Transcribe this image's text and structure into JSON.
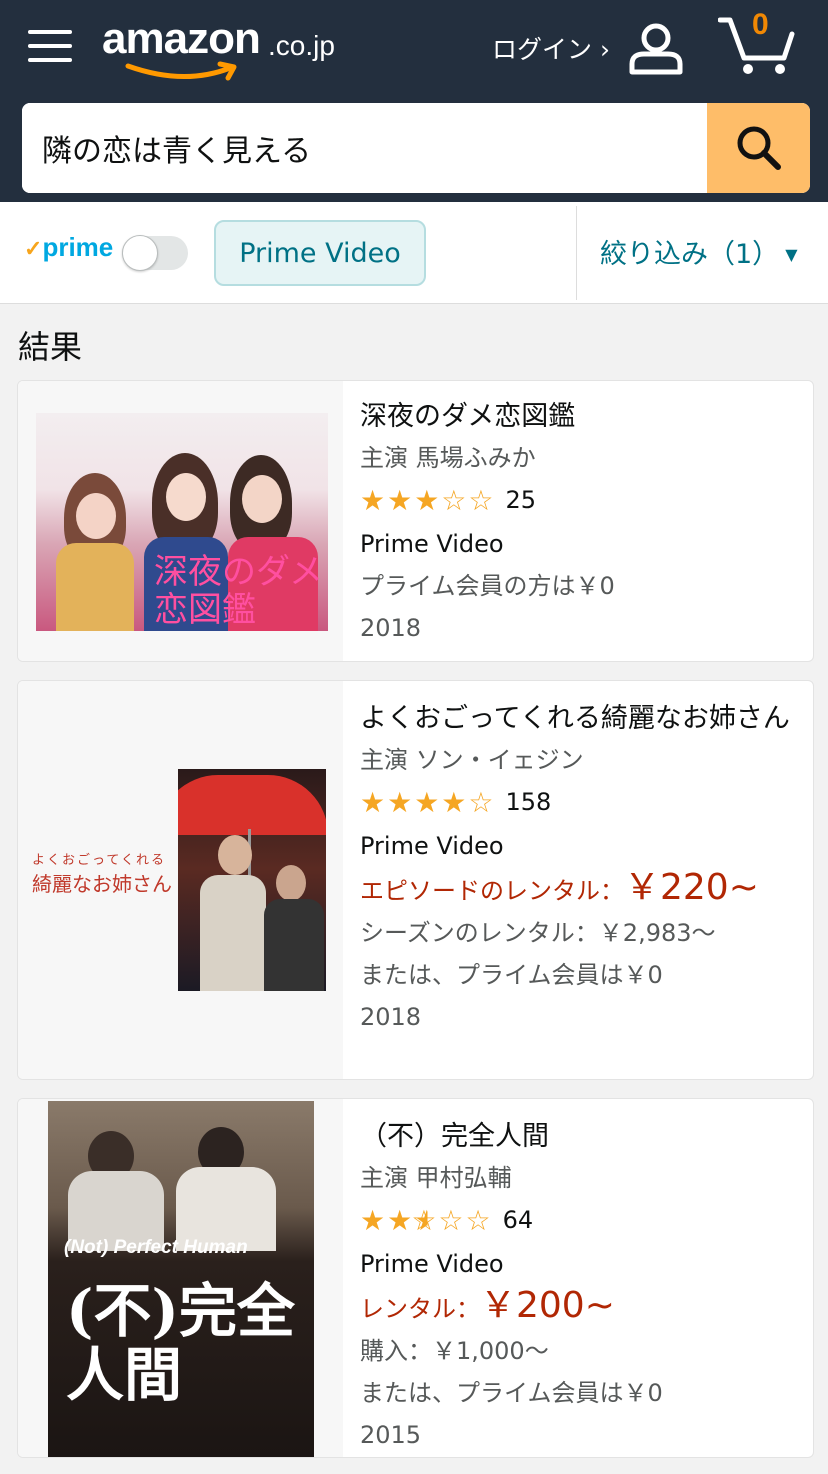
{
  "header": {
    "logo_word": "amazon",
    "logo_tld": ".co.jp",
    "login_label": "ログイン ›",
    "cart_count": "0"
  },
  "search": {
    "value": "隣の恋は青く見える"
  },
  "filters": {
    "prime_label": "prime",
    "prime_toggle_on": false,
    "chip_label": "Prime Video",
    "refine_label": "絞り込み（1）"
  },
  "results_heading": "結果",
  "results": [
    {
      "title": "深夜のダメ恋図鑑",
      "starring": "主演 馬場ふみか",
      "rating": 3,
      "rating_count": "25",
      "format": "Prime Video",
      "price_lines": [
        {
          "text": "プライム会員の方は￥0",
          "style": "gray"
        }
      ],
      "year": "2018",
      "poster_text": "深夜のダメ恋図鑑"
    },
    {
      "title": "よくおごってくれる綺麗なお姉さん",
      "starring": "主演 ソン・イェジン",
      "rating": 4,
      "rating_count": "158",
      "format": "Prime Video",
      "rental_label": "エピソードのレンタル：",
      "rental_price": "￥220~",
      "price_lines": [
        {
          "text": "シーズンのレンタル：￥2,983～",
          "style": "gray"
        },
        {
          "text": "または、プライム会員は￥0",
          "style": "gray"
        }
      ],
      "year": "2018",
      "poster_text_small": "よくおごってくれる",
      "poster_text": "綺麗なお姉さん"
    },
    {
      "title": "（不）完全人間",
      "starring": "主演 甲村弘輔",
      "rating": 2.5,
      "rating_count": "64",
      "format": "Prime Video",
      "rental_label": "レンタル：",
      "rental_price": "￥200~",
      "price_lines": [
        {
          "text": "購入：￥1,000～",
          "style": "gray"
        },
        {
          "text": "または、プライム会員は￥0",
          "style": "gray"
        }
      ],
      "year": "2015",
      "poster_text_small": "(Not) Perfect Human",
      "poster_text": "(不)完全人間"
    }
  ],
  "colors": {
    "header_bg": "#232f3e",
    "search_button": "#febd69",
    "link": "#007185",
    "price_red": "#b12704",
    "star": "#f5a623",
    "cart_count": "#f08804"
  }
}
